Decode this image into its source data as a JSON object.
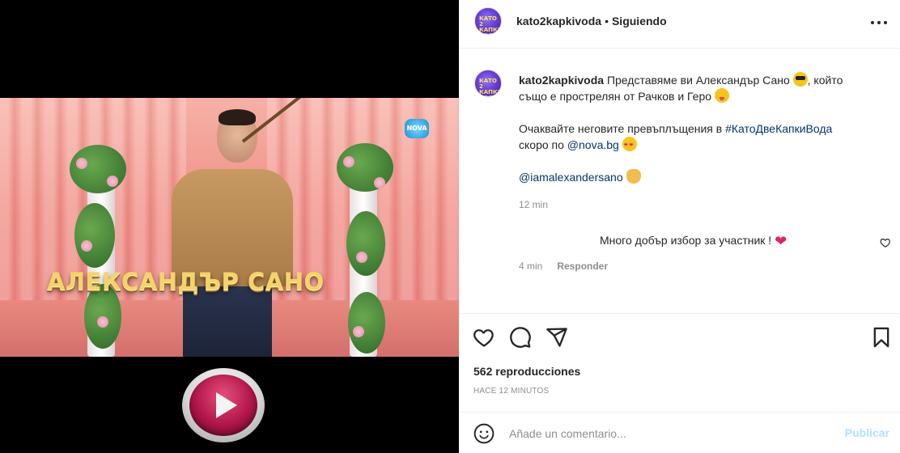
{
  "post": {
    "video_overlay_text": "АЛЕКСАНДЪР САНО",
    "channel_logo_text": "NOVA"
  },
  "header": {
    "username": "kato2kapkivoda",
    "separator": "•",
    "follow_state": "Siguiendo"
  },
  "caption": {
    "username": "kato2kapkivoda",
    "line1": "Представяме ви Александър Сано",
    "line1_after": ", който",
    "line2": "също е прострелян от Рачков и Геро",
    "line3": "Очаквайте неговите превъплъщения в",
    "hashtag": "#КатоДвеКапкиВода",
    "line4": "скоро по",
    "mention_nova": "@nova.bg",
    "mention_person": "@iamalexandersano",
    "time": "12 min"
  },
  "comment": {
    "text": "Много добър избор за участник !",
    "time": "4 min",
    "reply_label": "Responder"
  },
  "stats": {
    "views": "562 reproducciones",
    "time_ago": "HACE 12 MINUTOS"
  },
  "composer": {
    "placeholder": "Añade un comentario...",
    "publish_label": "Publicar"
  },
  "colors": {
    "link": "#00376b",
    "publish_disabled": "#b2dffc",
    "play_button": "#b0154a"
  }
}
